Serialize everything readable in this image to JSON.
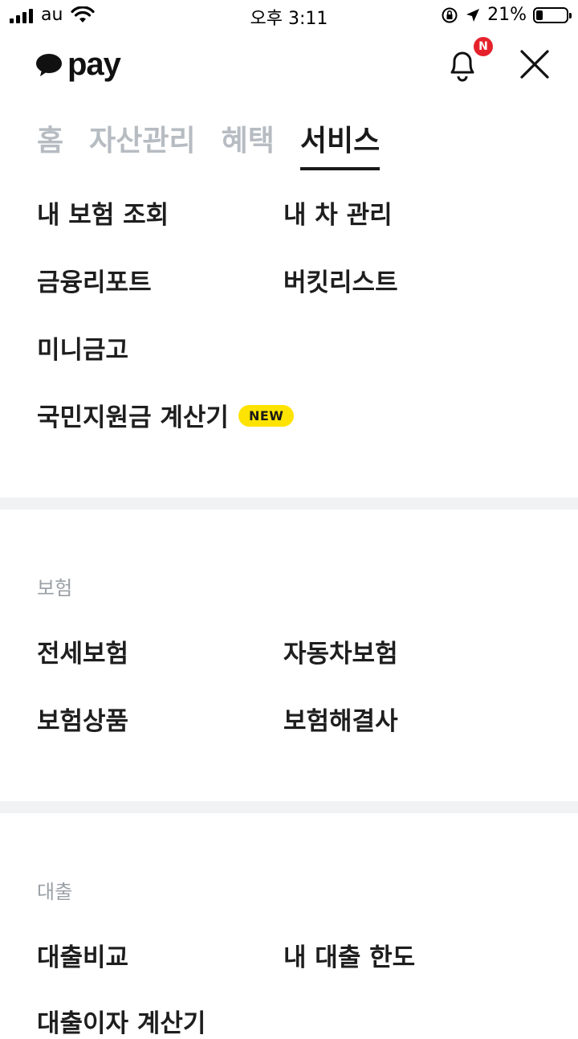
{
  "status_bar": {
    "carrier": "au",
    "time": "오후 3:11",
    "battery_percent": "21%",
    "battery_level": 0.21
  },
  "header": {
    "logo_text": "pay",
    "notification_badge": "N"
  },
  "tabs": [
    {
      "label": "홈",
      "active": false
    },
    {
      "label": "자산관리",
      "active": false
    },
    {
      "label": "혜택",
      "active": false
    },
    {
      "label": "서비스",
      "active": true
    }
  ],
  "services": {
    "items": [
      "내 보험 조회",
      "내 차 관리",
      "금융리포트",
      "버킷리스트",
      "미니금고",
      "국민지원금 계산기"
    ],
    "new_badge": "NEW"
  },
  "insurance": {
    "title": "보험",
    "items": [
      "전세보험",
      "자동차보험",
      "보험상품",
      "보험해결사"
    ]
  },
  "loan": {
    "title": "대출",
    "items": [
      "대출비교",
      "내 대출 한도",
      "대출이자 계산기"
    ]
  },
  "colors": {
    "accent_yellow": "#ffe300",
    "badge_red": "#e5222c",
    "inactive_tab": "#b6bcc2",
    "divider": "#f1f2f4"
  }
}
